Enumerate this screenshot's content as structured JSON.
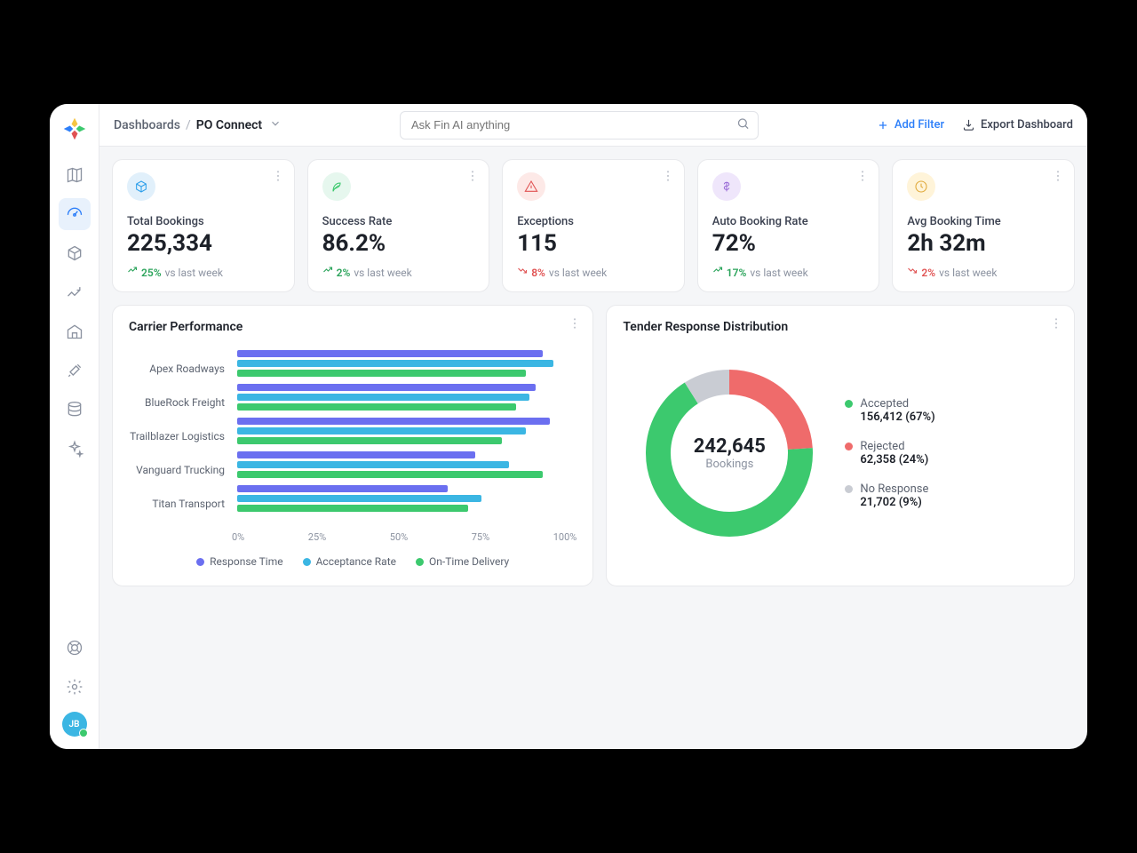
{
  "breadcrumb": {
    "root": "Dashboards",
    "sep": "/",
    "current": "PO Connect"
  },
  "search": {
    "placeholder": "Ask Fin AI anything"
  },
  "actions": {
    "add_filter": "Add Filter",
    "export": "Export Dashboard"
  },
  "kpi": [
    {
      "label": "Total Bookings",
      "value": "225,334",
      "delta_pct": "25%",
      "comparison": "vs last week",
      "trend": "up",
      "icon_bg": "#e1f0fb",
      "icon_color": "#2d9fea"
    },
    {
      "label": "Success Rate",
      "value": "86.2%",
      "delta_pct": "2%",
      "comparison": "vs last week",
      "trend": "up",
      "icon_bg": "#e6f7ee",
      "icon_color": "#3cc96e"
    },
    {
      "label": "Exceptions",
      "value": "115",
      "delta_pct": "8%",
      "comparison": "vs last week",
      "trend": "down",
      "icon_bg": "#fde9e7",
      "icon_color": "#e05252"
    },
    {
      "label": "Auto Booking Rate",
      "value": "72%",
      "delta_pct": "17%",
      "comparison": "vs last week",
      "trend": "up",
      "icon_bg": "#efe6fb",
      "icon_color": "#9b6dd7"
    },
    {
      "label": "Avg Booking Time",
      "value": "2h 32m",
      "delta_pct": "2%",
      "comparison": "vs last week",
      "trend": "down",
      "icon_bg": "#fff4d9",
      "icon_color": "#e0a93a"
    }
  ],
  "carrier": {
    "title": "Carrier Performance",
    "categories": [
      "Apex Roadways",
      "BlueRock Freight",
      "Trailblazer Logistics",
      "Vanguard Trucking",
      "Titan Transport"
    ],
    "series_names": [
      "Response Time",
      "Acceptance Rate",
      "On-Time Delivery"
    ],
    "x_ticks": [
      "0%",
      "25%",
      "50%",
      "75%",
      "100%"
    ]
  },
  "tender": {
    "title": "Tender Response Distribution",
    "center_value": "242,645",
    "center_label": "Bookings",
    "items": [
      {
        "name": "Accepted",
        "value": "156,412 (67%)",
        "color": "#3cc96e"
      },
      {
        "name": "Rejected",
        "value": "62,358 (24%)",
        "color": "#ef6b6b"
      },
      {
        "name": "No Response",
        "value": "21,702 (9%)",
        "color": "#c9ccd3"
      }
    ]
  },
  "avatar": "JB",
  "chart_data": [
    {
      "type": "bar",
      "orientation": "horizontal",
      "title": "Carrier Performance",
      "categories": [
        "Apex Roadways",
        "BlueRock Freight",
        "Trailblazer Logistics",
        "Vanguard Trucking",
        "Titan Transport"
      ],
      "series": [
        {
          "name": "Response Time",
          "values": [
            90,
            88,
            92,
            70,
            62
          ],
          "color": "#6b6ff0"
        },
        {
          "name": "Acceptance Rate",
          "values": [
            93,
            86,
            85,
            80,
            72
          ],
          "color": "#3bb6e3"
        },
        {
          "name": "On-Time Delivery",
          "values": [
            85,
            82,
            78,
            90,
            68
          ],
          "color": "#3cc96e"
        }
      ],
      "xlabel": "",
      "ylabel": "",
      "xlim": [
        0,
        100
      ],
      "x_ticks": [
        0,
        25,
        50,
        75,
        100
      ]
    },
    {
      "type": "pie",
      "title": "Tender Response Distribution",
      "total": 242645,
      "slices": [
        {
          "name": "Accepted",
          "value": 156412,
          "pct": 67,
          "color": "#3cc96e"
        },
        {
          "name": "Rejected",
          "value": 62358,
          "pct": 24,
          "color": "#ef6b6b"
        },
        {
          "name": "No Response",
          "value": 21702,
          "pct": 9,
          "color": "#c9ccd3"
        }
      ]
    }
  ]
}
